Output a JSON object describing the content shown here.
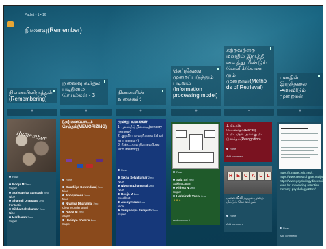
{
  "board": {
    "subtitle": "Padlet • 1 • 16",
    "title": "நினைவு(Remember)"
  },
  "columns": [
    {
      "header": "நினைவிலிருத்தல் (Remembering)"
    },
    {
      "header": "நினைவு கூர்தல் படிநிலை செயல்கள் - 3"
    },
    {
      "header": "நினைவின் வகைகள்:"
    },
    {
      "header": "செய்திகளை முறைப்படுத்தும் படிவம் (Information processing model)"
    },
    {
      "header": "கற்றவற்றை மனதில் இருத்தி வைத்து மீண்டும் வெளிக்கொண ரும் முறைகள்(Metho ds of Retrieval)"
    },
    {
      "header": "மனதில் இருத்தலை அளவிடும் முறைகள்"
    }
  ],
  "add_symbol": "+",
  "cards": {
    "c1": {
      "image_text": "Remember",
      "author": "Rose",
      "comments": [
        {
          "name": "Rooja M",
          "time": "2mo",
          "text": "Super"
        },
        {
          "name": "Suriyapriya Sampath",
          "time": "2mo",
          "text": "Nice"
        },
        {
          "name": "Sharmil Dhanapal",
          "time": "2mo",
          "text": "Fantastic"
        },
        {
          "name": "Sikha Selvakumar",
          "time": "2mo",
          "text": "Nice"
        },
        {
          "name": "Hariharan",
          "time": "2mo",
          "text": "Super"
        }
      ]
    },
    "c2": {
      "title": "(அ) மனப்பாடம் செய்தல்(MEMORIZING)",
      "author": "Rose",
      "comments": [
        {
          "name": "Dwathiya Gowindaraj",
          "time": "2mo",
          "text": "Nice"
        },
        {
          "name": "Anonymous",
          "time": "2mo",
          "text": "Nice"
        },
        {
          "name": "Nivarna Dhanamai",
          "time": "2mo",
          "text": "Clearly understand"
        },
        {
          "name": "Rooja M",
          "time": "2mo",
          "text": "Super"
        },
        {
          "name": "Haninya K Veeru",
          "time": "2mo",
          "text": "Super"
        }
      ]
    },
    "c3": {
      "title": "மூன்று வகைகள்",
      "lines": [
        "1. புலன்நீடு நினைவு(sensory memory)",
        "2. குறுகிய கால நினைவு(short term memory)",
        "3. நீண்ட கால நினைவு(long term memory)"
      ],
      "author": "Rose",
      "comments": [
        {
          "name": "Sikha Selvakumar",
          "time": "2mo",
          "text": "Nice"
        },
        {
          "name": "Nivarna Dhanamai",
          "time": "2mo",
          "text": "Nice"
        },
        {
          "name": "Rooja M",
          "time": "2mo",
          "text": "Excellent"
        },
        {
          "name": "Anonymous",
          "time": "2mo",
          "text": "Nice"
        },
        {
          "name": "Suriyapriya Sampath",
          "time": "2mo",
          "text": "Super"
        }
      ]
    },
    "c4": {
      "author": "Rose",
      "comments": [
        {
          "name": "Sala Sri",
          "time": "2mo",
          "text": "Sakha Lagan"
        },
        {
          "name": "Nithya N",
          "time": "2mo",
          "text": "Super"
        },
        {
          "name": "Hariniruth Veeru",
          "time": "2mo",
          "text": "★★★"
        }
      ],
      "add_comment": "Add comment"
    },
    "c5": {
      "lines": [
        "1. மீட்டுக் கொணர்தல்(Recall)",
        "2. மீட்டுதல் அல்லது மீட் டுணர்தல்(Recognition)"
      ],
      "author": "Rose",
      "add_comment": "Add comment",
      "image_text": "RECALL",
      "caption": "மனைவிலிருத்தல் முறை மீட்டுக் கொணர்தல்"
    },
    "c6": {
      "links": [
        "https://ir.nasret.edu.net/..",
        "https://www.researchgate.net/publication/..",
        "https://www.psychologydiscussion.net/learning/methods-used-for-measuring-retention-memory-psychology/2357/",
        "..."
      ],
      "author": "Rose",
      "add_comment": "Add comment"
    }
  },
  "colors": {
    "brown": "#8a4a1c",
    "navy": "#16387a",
    "green": "#1f5a2a",
    "maroon": "#7a1220",
    "teal_card": "#1d4e63"
  }
}
